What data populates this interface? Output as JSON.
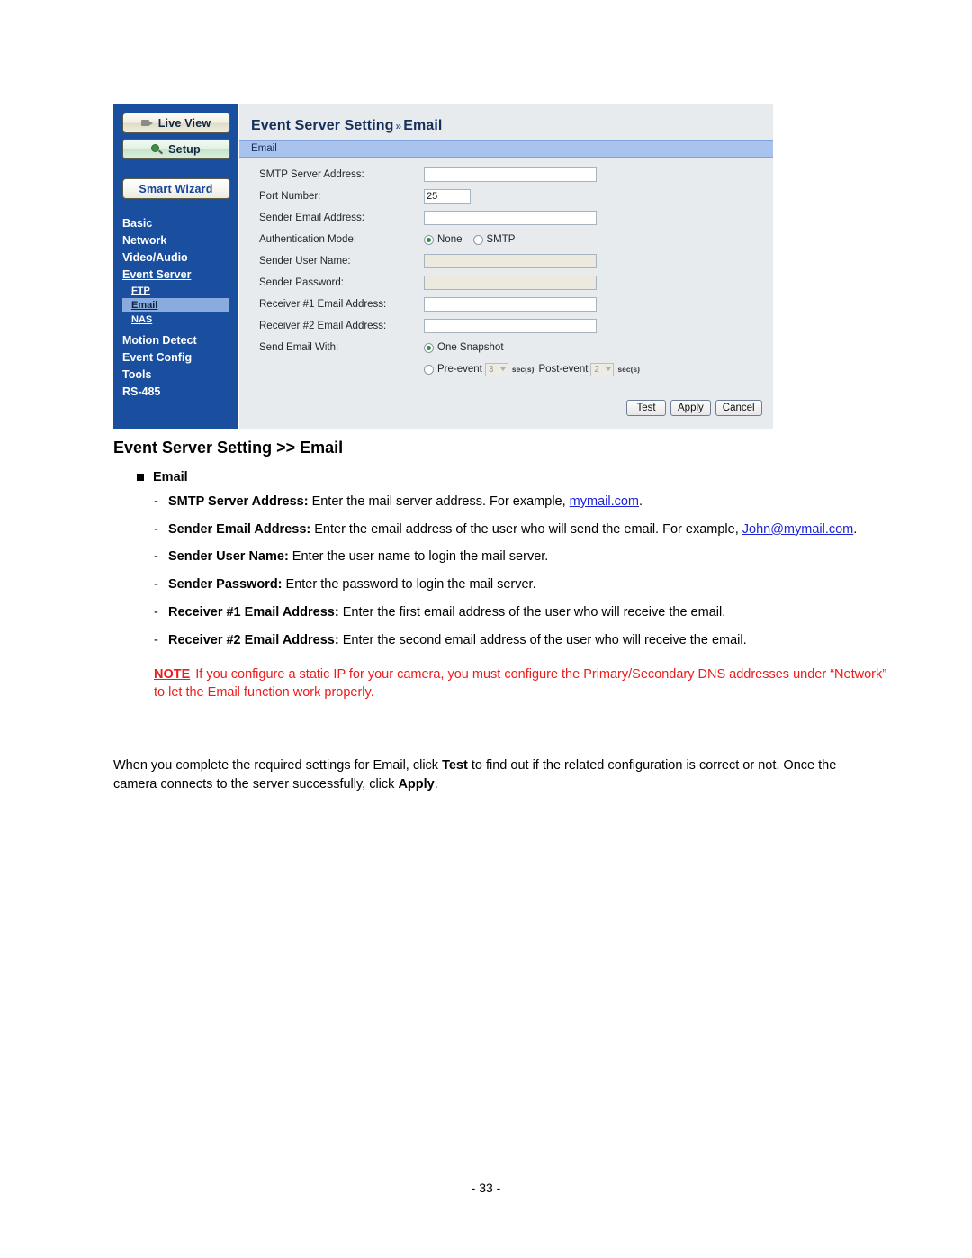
{
  "screenshot": {
    "sidebar": {
      "buttons": [
        {
          "label": "Live View",
          "icon": "camera-icon"
        },
        {
          "label": "Setup",
          "icon": "magnifier-icon"
        },
        {
          "label": "Smart Wizard",
          "icon": "none"
        }
      ],
      "menu": [
        {
          "label": "Basic"
        },
        {
          "label": "Network"
        },
        {
          "label": "Video/Audio"
        },
        {
          "label": "Event Server"
        },
        {
          "label": "Motion Detect"
        },
        {
          "label": "Event Config"
        },
        {
          "label": "Tools"
        },
        {
          "label": "RS-485"
        }
      ],
      "submenu": [
        {
          "label": "FTP",
          "selected": false
        },
        {
          "label": "Email",
          "selected": true
        },
        {
          "label": "NAS",
          "selected": false
        }
      ]
    },
    "panel": {
      "title_main": "Event Server Setting",
      "title_chev": "»",
      "title_sub": "Email",
      "section_bar": "Email",
      "fields": [
        {
          "label": "SMTP Server Address:",
          "value": "",
          "type": "text",
          "disabled": false
        },
        {
          "label": "Port Number:",
          "value": "25",
          "type": "text-narrow",
          "disabled": false
        },
        {
          "label": "Sender Email Address:",
          "value": "",
          "type": "text",
          "disabled": false
        },
        {
          "label": "Authentication Mode:",
          "value": "",
          "type": "radio-auth",
          "disabled": false
        },
        {
          "label": "Sender User Name:",
          "value": "",
          "type": "text",
          "disabled": true
        },
        {
          "label": "Sender Password:",
          "value": "",
          "type": "text",
          "disabled": true
        },
        {
          "label": "Receiver #1 Email Address:",
          "value": "",
          "type": "text",
          "disabled": false
        },
        {
          "label": "Receiver #2 Email Address:",
          "value": "",
          "type": "text",
          "disabled": false
        },
        {
          "label": "Send Email With:",
          "value": "",
          "type": "radio-send",
          "disabled": false
        }
      ],
      "auth_mode": {
        "option_none": "None",
        "option_smtp": "SMTP",
        "selected": "None"
      },
      "send_email_with": {
        "option_one_snapshot": "One Snapshot",
        "option_pre_event": "Pre-event",
        "pre_event_value": "3",
        "pre_event_unit": "sec(s)",
        "option_post_event": "Post-event",
        "post_event_value": "2",
        "post_event_unit": "sec(s)",
        "selected": "One Snapshot"
      },
      "buttons": [
        {
          "label": "Test"
        },
        {
          "label": "Apply"
        },
        {
          "label": "Cancel"
        }
      ]
    }
  },
  "document": {
    "heading": "Event Server Setting >> Email",
    "bullet_heading": "Email",
    "items": [
      {
        "term": "SMTP Server Address:",
        "text_before": " Enter the mail server address. For example, ",
        "link": "mymail.com",
        "text_after": ".",
        "link2": "",
        "text_after2": ""
      },
      {
        "term": "Sender Email Address:",
        "text_before": " Enter the email address of the user who will send the email. For example, ",
        "link": "John@mymail.com",
        "text_after": ".",
        "link2": "",
        "text_after2": ""
      },
      {
        "term": "Sender User Name:",
        "text_before": " Enter the user name to login the mail server.",
        "link": "",
        "text_after": "",
        "link2": "",
        "text_after2": ""
      },
      {
        "term": "Sender Password:",
        "text_before": " Enter the password to login the mail server.",
        "link": "",
        "text_after": "",
        "link2": "",
        "text_after2": ""
      },
      {
        "term": "Receiver #1 Email Address:",
        "text_before": " Enter the first email address of the user who will receive the email.",
        "link": "",
        "text_after": "",
        "link2": "",
        "text_after2": ""
      },
      {
        "term": "Receiver #2 Email Address:",
        "text_before": " Enter the second email address of the user who will receive the email.",
        "link": "",
        "text_after": "",
        "link2": "",
        "text_after2": ""
      }
    ],
    "note": {
      "label": "NOTE",
      "text": "If you configure a static IP for your camera, you must configure the Primary/Secondary DNS addresses under “Network” to let the Email function work properly."
    },
    "paragraph": {
      "part1": "When you complete the required settings for Email, click ",
      "bold1": "Test",
      "part2": " to find out if the related configuration is correct or not. Once the camera connects to the server successfully, click ",
      "bold2": "Apply",
      "part3": "."
    },
    "page_number": "- 33 -"
  },
  "colors": {
    "sidebar_bg": "#1a4fa0",
    "panel_bg": "#e7ebee",
    "section_bar": "#a9c2ee",
    "note_red": "#ee1b1b",
    "link_blue": "#1b24d6",
    "disabled_field": "#eceadf"
  }
}
